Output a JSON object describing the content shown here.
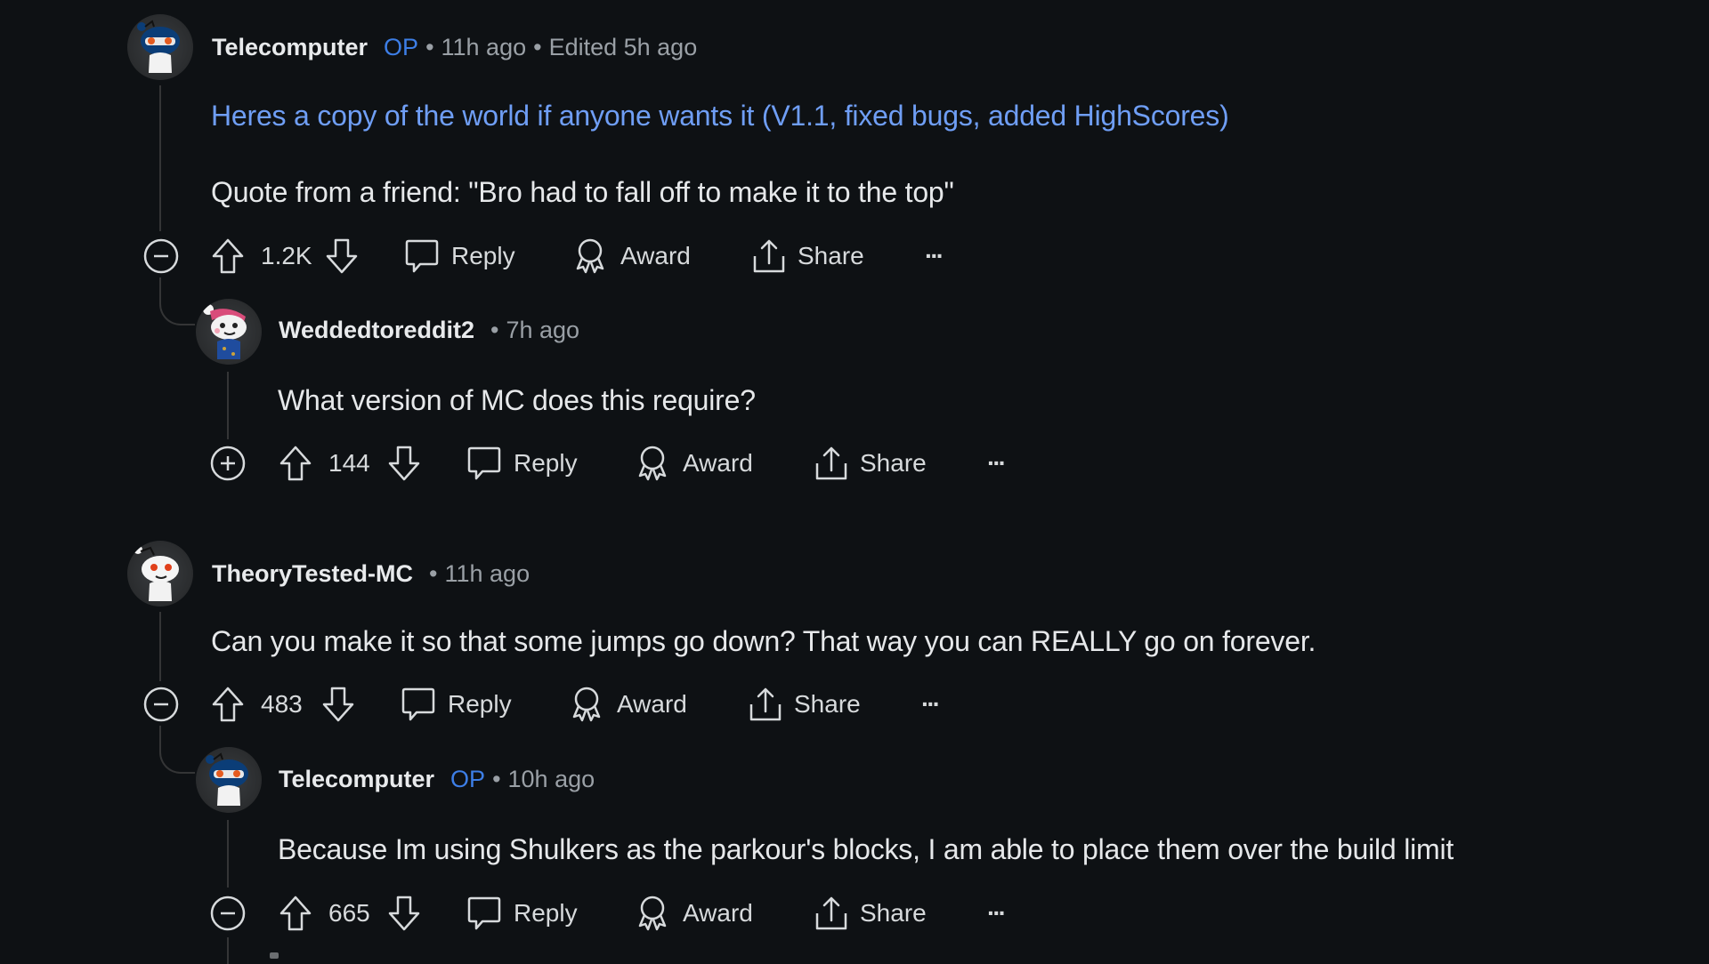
{
  "comments": [
    {
      "author": "Telecomputer",
      "op_badge": "OP",
      "separator": "•",
      "time": "11h ago",
      "edited": "Edited 5h ago",
      "link_text": "Heres a copy of the world if anyone wants it (V1.1, fixed bugs, added HighScores)",
      "text": "Quote from a friend: \"Bro had to fall off to make it to the top\"",
      "votes": "1.2K",
      "collapse_icon": "minus-circle-icon",
      "avatar": "snoo-ninja-avatar"
    },
    {
      "author": "Weddedtoreddit2",
      "separator": "•",
      "time": "7h ago",
      "text": "What version of MC does this require?",
      "votes": "144",
      "collapse_icon": "plus-circle-icon",
      "avatar": "snoo-santa-hat-avatar"
    },
    {
      "author": "TheoryTested-MC",
      "separator": "•",
      "time": "11h ago",
      "text": "Can you make it so that some jumps go down? That way you can REALLY go on forever.",
      "votes": "483",
      "collapse_icon": "minus-circle-icon",
      "avatar": "snoo-default-avatar"
    },
    {
      "author": "Telecomputer",
      "op_badge": "OP",
      "separator": "•",
      "time": "10h ago",
      "text": "Because Im using Shulkers as the parkour's blocks, I am able to place them over the build limit",
      "votes": "665",
      "collapse_icon": "minus-circle-icon",
      "avatar": "snoo-ninja-avatar"
    }
  ],
  "actions": {
    "reply": "Reply",
    "award": "Award",
    "share": "Share",
    "more": "···"
  },
  "colors": {
    "background": "#0e1114",
    "link": "#6f9ef5",
    "op_badge": "#3d7ee6",
    "meta_text": "#9aa0a6",
    "thread_line": "#343536"
  }
}
